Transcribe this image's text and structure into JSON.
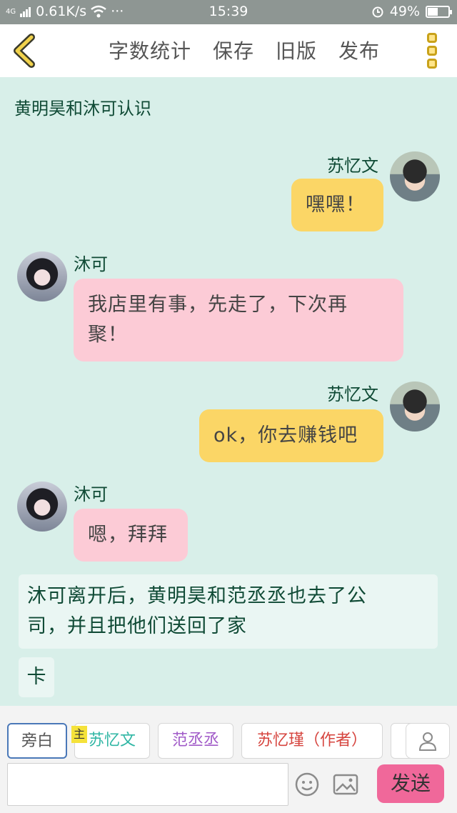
{
  "status": {
    "network": "4G",
    "speed": "0.61K/s",
    "more": "···",
    "time": "15:39",
    "battery": "49%"
  },
  "toolbar": {
    "word_count": "字数统计",
    "save": "保存",
    "old_version": "旧版",
    "publish": "发布"
  },
  "chat": {
    "title": "黄明昊和沐可认识",
    "messages": [
      {
        "speaker": "苏忆文",
        "side": "right",
        "text": "嘿嘿！"
      },
      {
        "speaker": "沐可",
        "side": "left",
        "text_line1": "我店里有事，先走了，下次再",
        "text_line2": "聚！"
      },
      {
        "speaker": "苏忆文",
        "side": "right",
        "text": "ok，你去赚钱吧"
      },
      {
        "speaker": "沐可",
        "side": "left",
        "text": "嗯，拜拜"
      }
    ],
    "narration_line1": "沐可离开后，黄明昊和范丞丞也去了公",
    "narration_line2": "司，并且把他们送回了家",
    "card_tag": "卡"
  },
  "composer": {
    "roles": [
      {
        "label": "旁白",
        "color": "#555555",
        "active": true
      },
      {
        "label": "苏忆文",
        "color": "#2fb6a4"
      },
      {
        "label": "范丞丞",
        "color": "#a15bc8"
      },
      {
        "label": "苏忆瑾（作者）",
        "color": "#d6453f"
      }
    ],
    "main_badge": "主",
    "input_value": "",
    "send_label": "发送"
  }
}
